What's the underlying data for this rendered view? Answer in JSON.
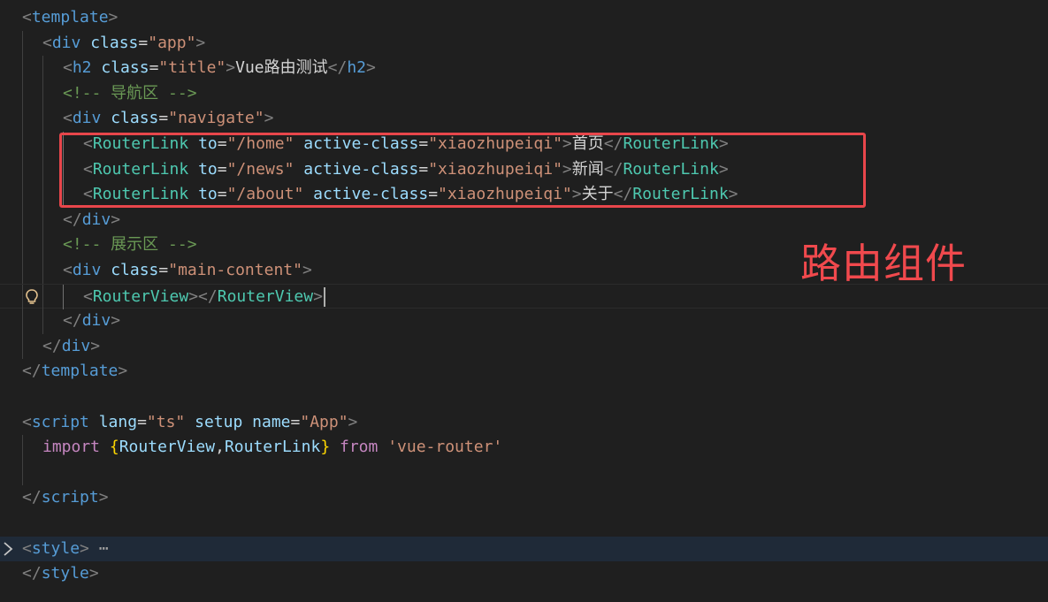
{
  "lines": [
    {
      "segments": [
        [
          "tag",
          "<"
        ],
        [
          "name",
          "template"
        ],
        [
          "tag",
          ">"
        ]
      ]
    },
    {
      "segments": [
        [
          "tag",
          "<"
        ],
        [
          "name",
          "div"
        ],
        [
          "text",
          " "
        ],
        [
          "attr",
          "class"
        ],
        [
          "text",
          "="
        ],
        [
          "str",
          "\"app\""
        ],
        [
          "tag",
          ">"
        ]
      ]
    },
    {
      "segments": [
        [
          "tag",
          "<"
        ],
        [
          "name",
          "h2"
        ],
        [
          "text",
          " "
        ],
        [
          "attr",
          "class"
        ],
        [
          "text",
          "="
        ],
        [
          "str",
          "\"title\""
        ],
        [
          "tag",
          ">"
        ],
        [
          "text",
          "Vue路由测试"
        ],
        [
          "tag",
          "</"
        ],
        [
          "name",
          "h2"
        ],
        [
          "tag",
          ">"
        ]
      ]
    },
    {
      "segments": [
        [
          "com",
          "<!-- 导航区 -->"
        ]
      ]
    },
    {
      "segments": [
        [
          "tag",
          "<"
        ],
        [
          "name",
          "div"
        ],
        [
          "text",
          " "
        ],
        [
          "attr",
          "class"
        ],
        [
          "text",
          "="
        ],
        [
          "str",
          "\"navigate\""
        ],
        [
          "tag",
          ">"
        ]
      ]
    },
    {
      "segments": [
        [
          "tag",
          "<"
        ],
        [
          "comp",
          "RouterLink"
        ],
        [
          "text",
          " "
        ],
        [
          "attr",
          "to"
        ],
        [
          "text",
          "="
        ],
        [
          "str",
          "\"/home\""
        ],
        [
          "text",
          " "
        ],
        [
          "attr",
          "active-class"
        ],
        [
          "text",
          "="
        ],
        [
          "str",
          "\"xiaozhupeiqi\""
        ],
        [
          "tag",
          ">"
        ],
        [
          "text",
          "首页"
        ],
        [
          "tag",
          "</"
        ],
        [
          "comp",
          "RouterLink"
        ],
        [
          "tag",
          ">"
        ]
      ]
    },
    {
      "segments": [
        [
          "tag",
          "<"
        ],
        [
          "comp",
          "RouterLink"
        ],
        [
          "text",
          " "
        ],
        [
          "attr",
          "to"
        ],
        [
          "text",
          "="
        ],
        [
          "str",
          "\"/news\""
        ],
        [
          "text",
          " "
        ],
        [
          "attr",
          "active-class"
        ],
        [
          "text",
          "="
        ],
        [
          "str",
          "\"xiaozhupeiqi\""
        ],
        [
          "tag",
          ">"
        ],
        [
          "text",
          "新闻"
        ],
        [
          "tag",
          "</"
        ],
        [
          "comp",
          "RouterLink"
        ],
        [
          "tag",
          ">"
        ]
      ]
    },
    {
      "segments": [
        [
          "tag",
          "<"
        ],
        [
          "comp",
          "RouterLink"
        ],
        [
          "text",
          " "
        ],
        [
          "attr",
          "to"
        ],
        [
          "text",
          "="
        ],
        [
          "str",
          "\"/about\""
        ],
        [
          "text",
          " "
        ],
        [
          "attr",
          "active-class"
        ],
        [
          "text",
          "="
        ],
        [
          "str",
          "\"xiaozhupeiqi\""
        ],
        [
          "tag",
          ">"
        ],
        [
          "text",
          "关于"
        ],
        [
          "tag",
          "</"
        ],
        [
          "comp",
          "RouterLink"
        ],
        [
          "tag",
          ">"
        ]
      ]
    },
    {
      "segments": [
        [
          "tag",
          "</"
        ],
        [
          "name",
          "div"
        ],
        [
          "tag",
          ">"
        ]
      ]
    },
    {
      "segments": [
        [
          "com",
          "<!-- 展示区 -->"
        ]
      ]
    },
    {
      "segments": [
        [
          "tag",
          "<"
        ],
        [
          "name",
          "div"
        ],
        [
          "text",
          " "
        ],
        [
          "attr",
          "class"
        ],
        [
          "text",
          "="
        ],
        [
          "str",
          "\"main-content\""
        ],
        [
          "tag",
          ">"
        ]
      ]
    },
    {
      "segments": [
        [
          "tag",
          "<"
        ],
        [
          "comp",
          "RouterView"
        ],
        [
          "tag",
          "></"
        ],
        [
          "comp",
          "RouterView"
        ],
        [
          "tag",
          ">"
        ]
      ]
    },
    {
      "segments": [
        [
          "tag",
          "</"
        ],
        [
          "name",
          "div"
        ],
        [
          "tag",
          ">"
        ]
      ]
    },
    {
      "segments": [
        [
          "tag",
          "</"
        ],
        [
          "name",
          "div"
        ],
        [
          "tag",
          ">"
        ]
      ]
    },
    {
      "segments": [
        [
          "tag",
          "</"
        ],
        [
          "name",
          "template"
        ],
        [
          "tag",
          ">"
        ]
      ]
    },
    {
      "segments": []
    },
    {
      "segments": [
        [
          "tag",
          "<"
        ],
        [
          "name",
          "script"
        ],
        [
          "text",
          " "
        ],
        [
          "attr",
          "lang"
        ],
        [
          "text",
          "="
        ],
        [
          "str",
          "\"ts\""
        ],
        [
          "text",
          " "
        ],
        [
          "attr",
          "setup"
        ],
        [
          "text",
          " "
        ],
        [
          "attr",
          "name"
        ],
        [
          "text",
          "="
        ],
        [
          "str",
          "\"App\""
        ],
        [
          "tag",
          ">"
        ]
      ]
    },
    {
      "segments": [
        [
          "kw",
          "import"
        ],
        [
          "text",
          " "
        ],
        [
          "brace",
          "{"
        ],
        [
          "attr",
          "RouterView"
        ],
        [
          "text",
          ","
        ],
        [
          "attr",
          "RouterLink"
        ],
        [
          "brace",
          "}"
        ],
        [
          "text",
          " "
        ],
        [
          "kw",
          "from"
        ],
        [
          "text",
          " "
        ],
        [
          "str",
          "'vue-router'"
        ]
      ]
    },
    {
      "segments": []
    },
    {
      "segments": [
        [
          "tag",
          "</"
        ],
        [
          "name",
          "script"
        ],
        [
          "tag",
          ">"
        ]
      ]
    },
    {
      "segments": []
    },
    {
      "segments": [
        [
          "tag",
          "<"
        ],
        [
          "name",
          "style"
        ],
        [
          "tag",
          ">"
        ],
        [
          "ell",
          " ⋯"
        ]
      ]
    },
    {
      "segments": [
        [
          "tag",
          "</"
        ],
        [
          "name",
          "style"
        ],
        [
          "tag",
          ">"
        ]
      ]
    }
  ],
  "annotation": {
    "label": "路由组件"
  },
  "icons": {
    "lightbulb": "lightbulb-icon",
    "fold": "chevron-right-icon"
  },
  "colors": {
    "background": "#1f1f1f",
    "annotation": "#f0494d",
    "highlight_border": "#e8464b"
  }
}
